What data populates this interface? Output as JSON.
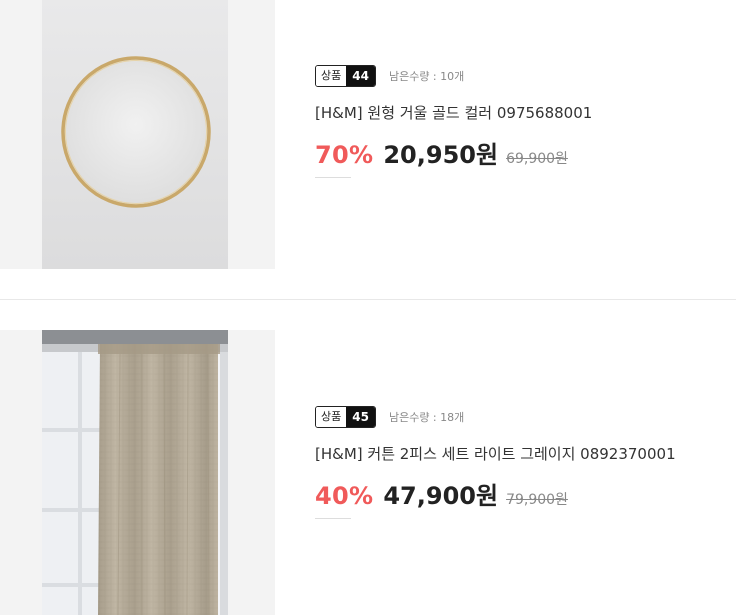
{
  "products": [
    {
      "badge_label": "상품",
      "badge_number": "44",
      "stock": "남은수량 : 10개",
      "title": "[H&M] 원형 거울 골드 컬러 0975688001",
      "discount": "70%",
      "price": "20,950원",
      "original_price": "69,900원",
      "image": "round-gold-mirror"
    },
    {
      "badge_label": "상품",
      "badge_number": "45",
      "stock": "남은수량 : 18개",
      "title": "[H&M] 커튼 2피스 세트 라이트 그레이지 0892370001",
      "discount": "40%",
      "price": "47,900원",
      "original_price": "79,900원",
      "image": "greige-linen-curtain"
    }
  ],
  "colors": {
    "discount": "#f05a5a",
    "badge_dark": "#111111",
    "mirror_frame": "#c9a86a",
    "curtain": "#b8ad98"
  }
}
